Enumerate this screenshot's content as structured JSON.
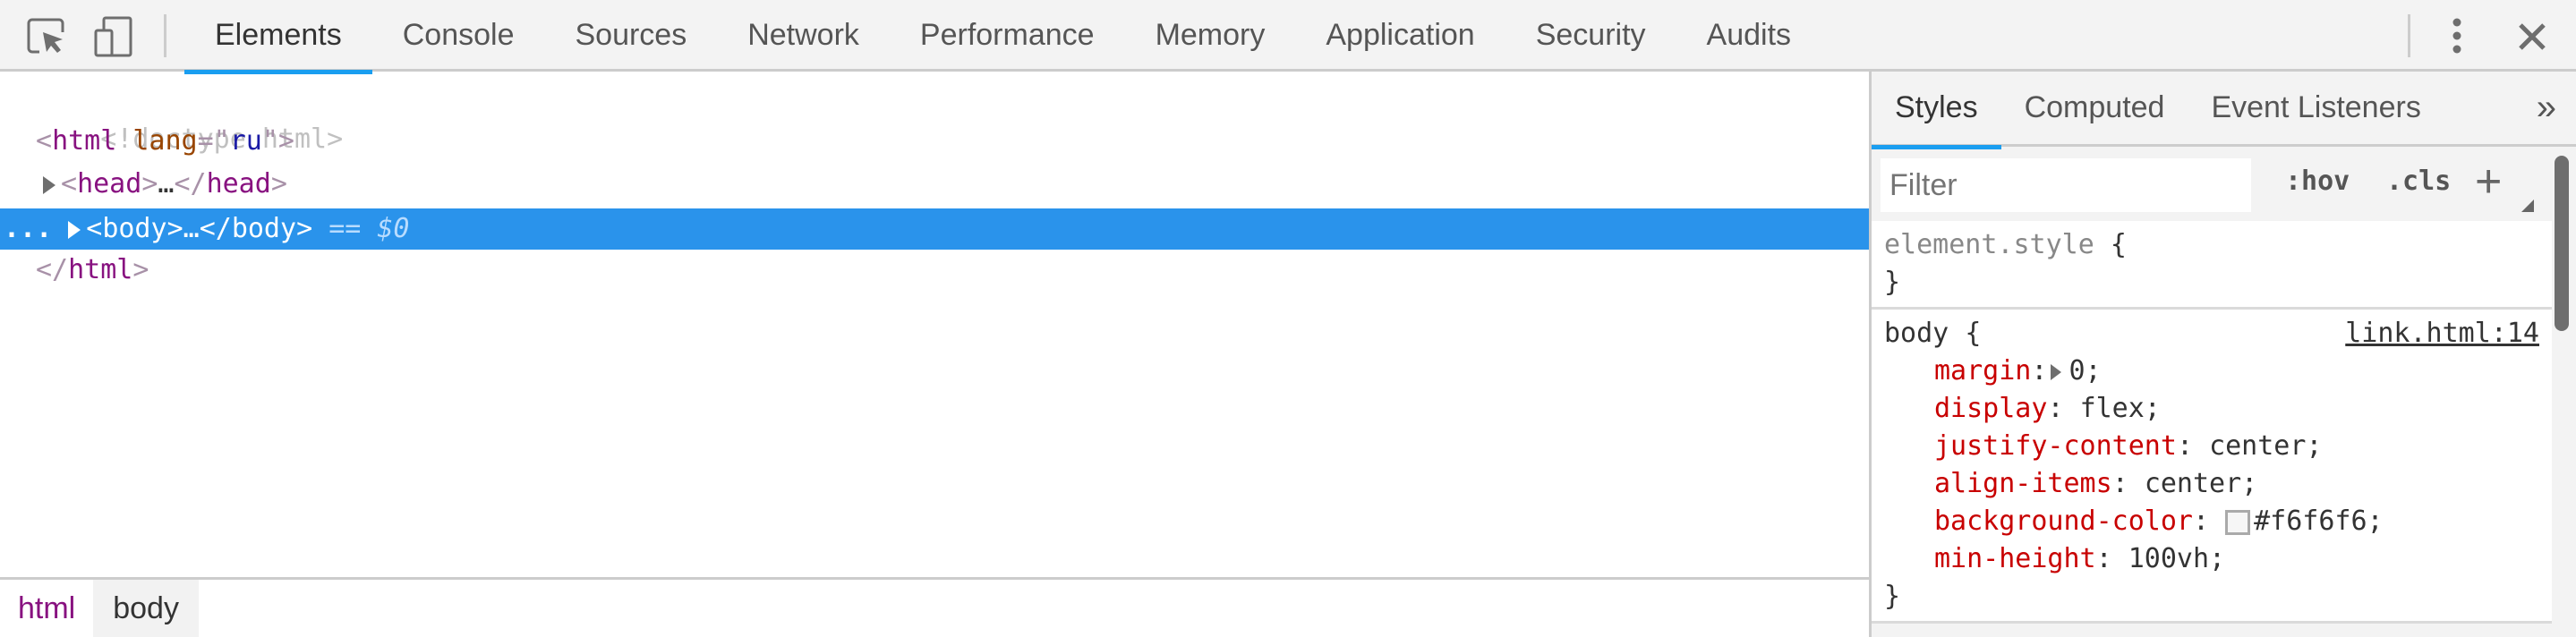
{
  "toolbar": {
    "inspect_icon": "inspect-element-icon",
    "device_icon": "device-toolbar-icon",
    "menu_icon": "kebab-menu-icon",
    "close_icon": "close-icon"
  },
  "tabs": [
    {
      "label": "Elements",
      "active": true
    },
    {
      "label": "Console"
    },
    {
      "label": "Sources"
    },
    {
      "label": "Network"
    },
    {
      "label": "Performance"
    },
    {
      "label": "Memory"
    },
    {
      "label": "Application"
    },
    {
      "label": "Security"
    },
    {
      "label": "Audits"
    }
  ],
  "dom_tree": {
    "doctype": "<!doctype html>",
    "html_open": {
      "tag": "html",
      "attr": "lang",
      "value": "ru"
    },
    "head": {
      "open": "head",
      "ellipsis": "…",
      "close": "head"
    },
    "body": {
      "open": "body",
      "ellipsis": "…",
      "close": "body",
      "console_ref": "== $0",
      "dots": "..."
    },
    "html_close": "html"
  },
  "breadcrumb": [
    "html",
    "body"
  ],
  "sidebar": {
    "tabs": [
      {
        "label": "Styles",
        "active": true
      },
      {
        "label": "Computed"
      },
      {
        "label": "Event Listeners"
      }
    ],
    "more_label": "»",
    "filter_placeholder": "Filter",
    "hov_label": ":hov",
    "cls_label": ".cls",
    "new_rule_label": "+",
    "element_style": {
      "selector": "element.style",
      "open": "{",
      "close": "}"
    },
    "body_rule": {
      "selector": "body",
      "open": "{",
      "close": "}",
      "source": "link.html:14",
      "declarations": [
        {
          "prop": "margin",
          "value": "0;",
          "expandable": true
        },
        {
          "prop": "display",
          "value": "flex;"
        },
        {
          "prop": "justify-content",
          "value": "center;"
        },
        {
          "prop": "align-items",
          "value": "center;"
        },
        {
          "prop": "background-color",
          "value": "#f6f6f6;",
          "swatch": "#f6f6f6"
        },
        {
          "prop": "min-height",
          "value": "100vh;"
        }
      ]
    }
  }
}
